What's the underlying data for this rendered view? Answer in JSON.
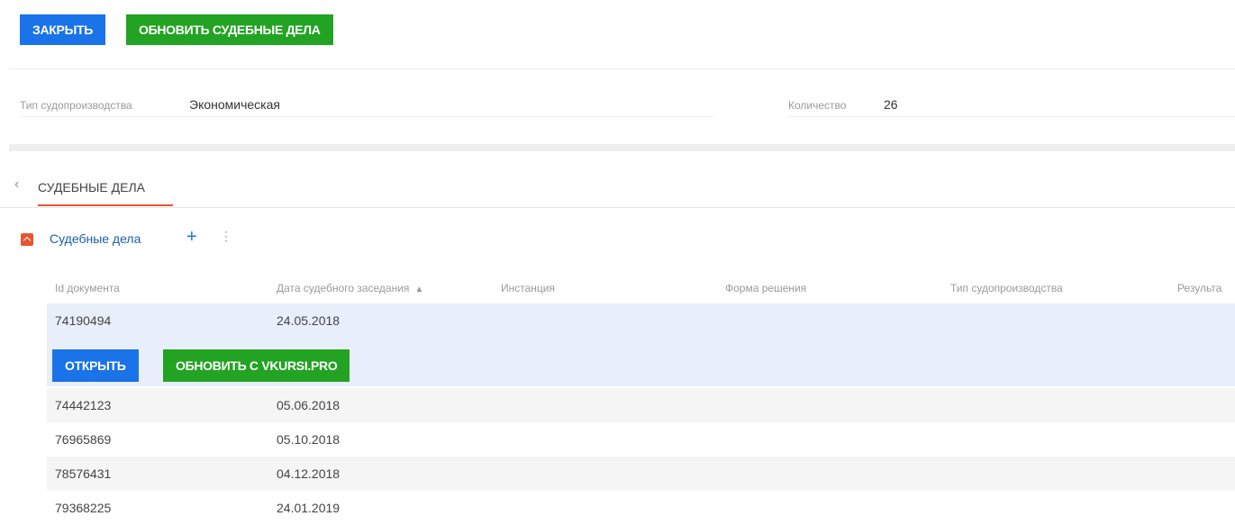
{
  "toolbar": {
    "close_label": "ЗАКРЫТЬ",
    "update_cases_label": "ОБНОВИТЬ СУДЕБНЫЕ ДЕЛА"
  },
  "fields": {
    "proceeding_type": {
      "label": "Тип судопроизводства",
      "value": "Экономическая"
    },
    "count": {
      "label": "Количество",
      "value": "26"
    }
  },
  "tabs": [
    {
      "label": "СУДЕБНЫЕ ДЕЛА",
      "active": true
    }
  ],
  "section": {
    "title": "Судебные дела",
    "icon": "collapse-icon",
    "add_icon": "plus-icon",
    "menu_icon": "more-vertical-icon"
  },
  "table": {
    "columns": [
      "Id документа",
      "Дата судебного заседания",
      "Инстанция",
      "Форма решения",
      "Тип судопроизводства",
      "Результа"
    ],
    "sort_icon": "sort-asc-icon",
    "rows": [
      {
        "id": "74190494",
        "date": "24.05.2018",
        "selected": true
      },
      {
        "id": "74442123",
        "date": "05.06.2018"
      },
      {
        "id": "76965869",
        "date": "05.10.2018"
      },
      {
        "id": "78576431",
        "date": "04.12.2018"
      },
      {
        "id": "79368225",
        "date": "24.01.2019"
      }
    ],
    "row_actions": {
      "open_label": "ОТКРЫТЬ",
      "update_label": "ОБНОВИТЬ С VKURSI.PRO"
    }
  },
  "colors": {
    "primary_blue": "#1a73e8",
    "green": "#23a323",
    "accent_orange": "#e8542f",
    "selected_row": "#e8eefa"
  }
}
